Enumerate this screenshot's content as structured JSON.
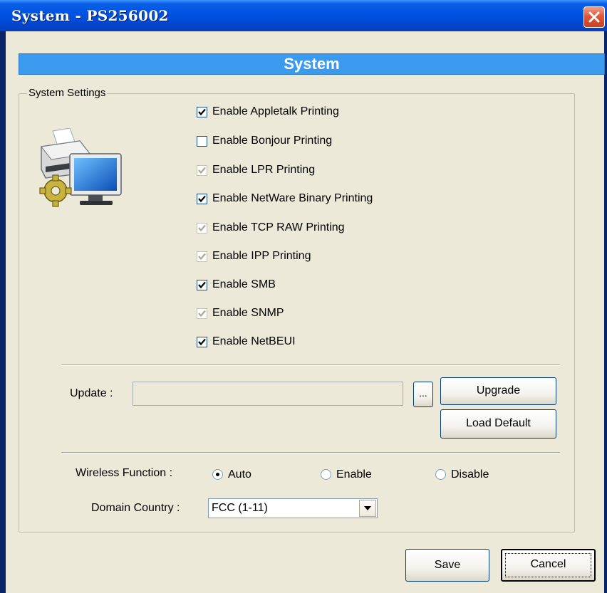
{
  "window": {
    "title": "System - PS256002"
  },
  "banner": {
    "title": "System"
  },
  "system_settings": {
    "group_label": "System Settings",
    "checkboxes": [
      {
        "label": "Enable Appletalk Printing",
        "checked": true,
        "enabled": true
      },
      {
        "label": "Enable Bonjour Printing",
        "checked": false,
        "enabled": true
      },
      {
        "label": "Enable LPR Printing",
        "checked": true,
        "enabled": false
      },
      {
        "label": "Enable NetWare Binary Printing",
        "checked": true,
        "enabled": true
      },
      {
        "label": "Enable TCP RAW Printing",
        "checked": true,
        "enabled": false
      },
      {
        "label": "Enable IPP Printing",
        "checked": true,
        "enabled": false
      },
      {
        "label": "Enable SMB",
        "checked": true,
        "enabled": true
      },
      {
        "label": "Enable SNMP",
        "checked": true,
        "enabled": false
      },
      {
        "label": "Enable NetBEUI",
        "checked": true,
        "enabled": true
      }
    ]
  },
  "update": {
    "label": "Update :",
    "value": "",
    "browse_label": "...",
    "upgrade_label": "Upgrade",
    "load_default_label": "Load Default"
  },
  "wireless": {
    "label": "Wireless Function :",
    "options": [
      {
        "label": "Auto",
        "selected": true
      },
      {
        "label": "Enable",
        "selected": false
      },
      {
        "label": "Disable",
        "selected": false
      }
    ]
  },
  "domain": {
    "label": "Domain Country :",
    "selected": "FCC (1-11)"
  },
  "footer": {
    "save_label": "Save",
    "cancel_label": "Cancel"
  },
  "colors": {
    "titlebar": "#0054e3",
    "banner": "#3c9aee",
    "dialog_bg": "#ece9d8"
  }
}
